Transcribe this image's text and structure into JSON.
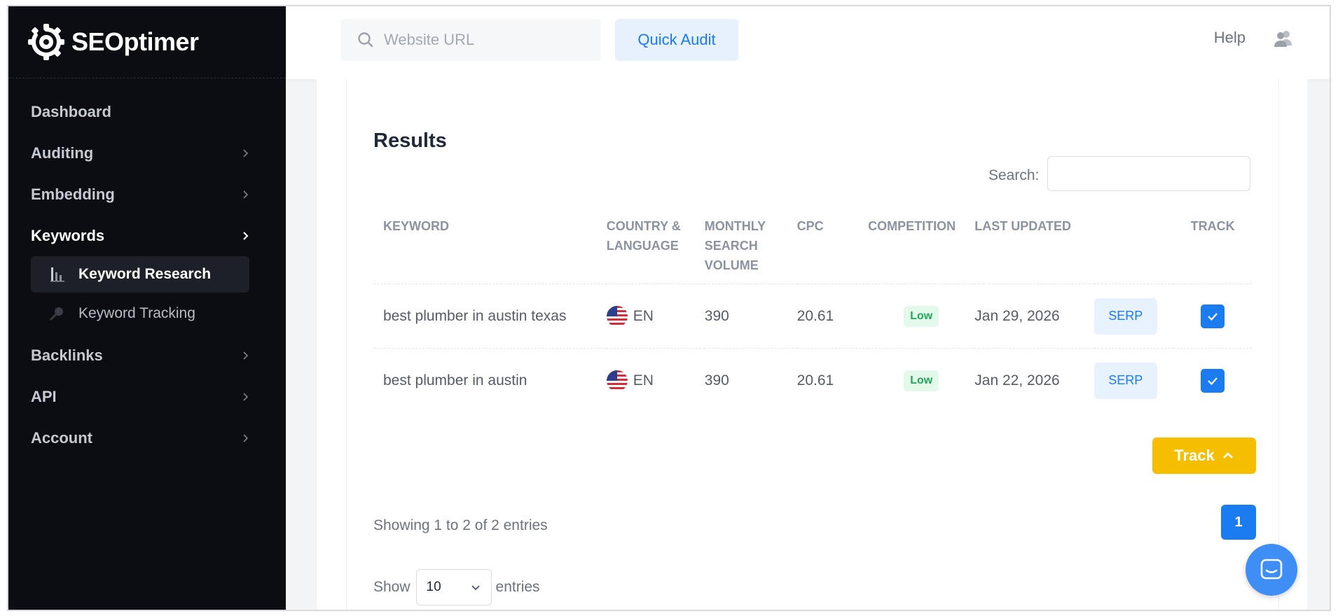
{
  "brand": {
    "name": "SEOptimer"
  },
  "sidebar": {
    "items": [
      {
        "label": "Dashboard"
      },
      {
        "label": "Auditing"
      },
      {
        "label": "Embedding"
      },
      {
        "label": "Keywords"
      },
      {
        "label": "Backlinks"
      },
      {
        "label": "API"
      },
      {
        "label": "Account"
      }
    ],
    "subitems": [
      {
        "label": "Keyword Research",
        "icon": "bar-chart-icon"
      },
      {
        "label": "Keyword Tracking",
        "icon": "magnifier-icon"
      }
    ]
  },
  "header": {
    "url_placeholder": "Website URL",
    "audit_label": "Quick Audit",
    "help_label": "Help"
  },
  "results": {
    "title": "Results",
    "search_label": "Search:",
    "columns": {
      "keyword": "KEYWORD",
      "country": "COUNTRY & LANGUAGE",
      "volume": "MONTHLY SEARCH VOLUME",
      "cpc": "CPC",
      "competition": "COMPETITION",
      "updated": "LAST UPDATED",
      "track": "TRACK"
    },
    "rows": [
      {
        "keyword": "best plumber in austin texas",
        "lang": "EN",
        "volume": "390",
        "cpc": "20.61",
        "competition": "Low",
        "updated": "Jan 29, 2026",
        "serp": "SERP"
      },
      {
        "keyword": "best plumber in austin",
        "lang": "EN",
        "volume": "390",
        "cpc": "20.61",
        "competition": "Low",
        "updated": "Jan 22, 2026",
        "serp": "SERP"
      }
    ],
    "track_button": "Track",
    "showing": "Showing 1 to 2 of 2 entries",
    "page": "1",
    "show_label": "Show",
    "page_size": "10",
    "entries_label": "entries"
  },
  "colors": {
    "accent": "#1a7cf0",
    "track": "#f5bf00",
    "sidebar_bg": "#0b0d12",
    "low_badge": "#22a55b"
  }
}
